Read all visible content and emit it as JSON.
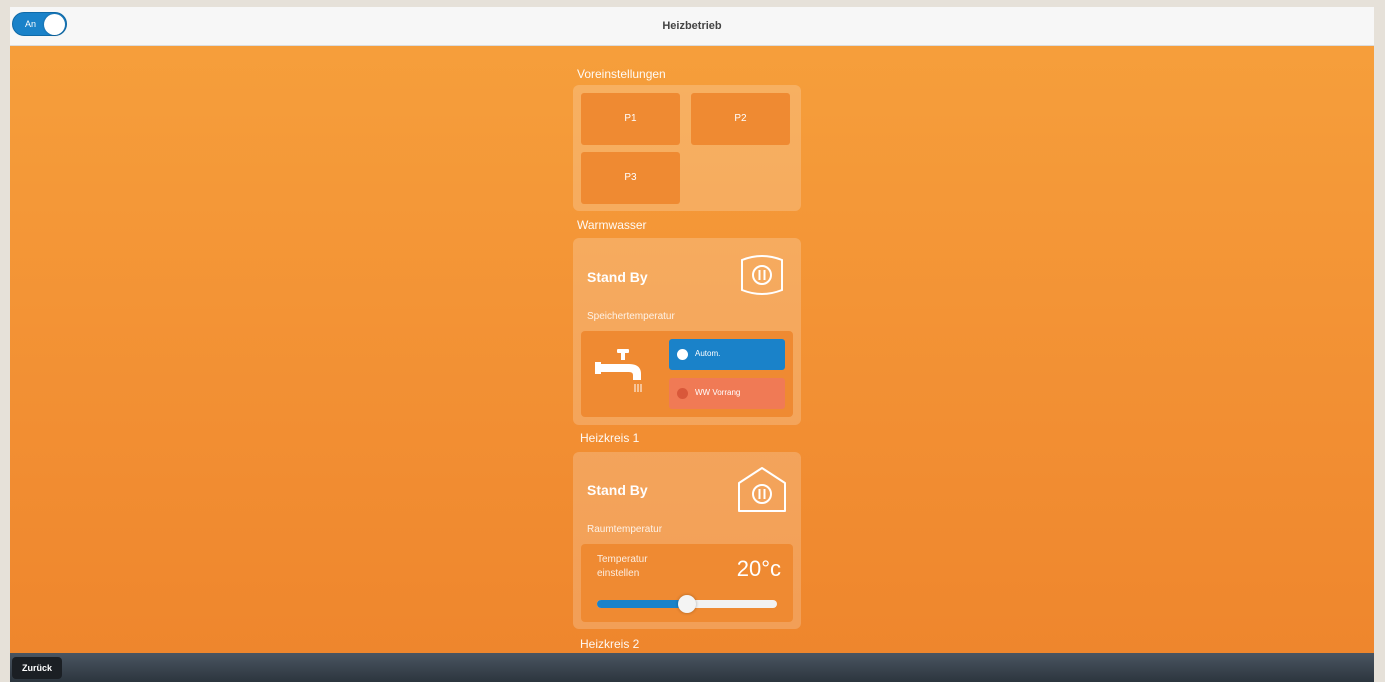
{
  "header": {
    "toggle_label": "An",
    "title": "Heizbetrieb"
  },
  "presets": {
    "label": "Voreinstellungen",
    "buttons": [
      "P1",
      "P2",
      "P3"
    ]
  },
  "warmwasser": {
    "label": "Warmwasser",
    "status": "Stand By",
    "sublabel": "Speichertemperatur",
    "options": [
      {
        "label": "Autom.",
        "active": true
      },
      {
        "label": "WW Vorrang",
        "active": false
      }
    ]
  },
  "heizkreis1": {
    "label": "Heizkreis 1",
    "status": "Stand By",
    "sublabel": "Raumtemperatur",
    "setting_label_line1": "Temperatur",
    "setting_label_line2": "einstellen",
    "temperature": "20°c",
    "slider_fraction": 0.5
  },
  "heizkreis2": {
    "label": "Heizkreis 2"
  },
  "footer": {
    "back_label": "Zurück"
  },
  "colors": {
    "accent_blue": "#1a82c9",
    "orange": "#f28f33",
    "inactive_chip": "#f07a55"
  }
}
